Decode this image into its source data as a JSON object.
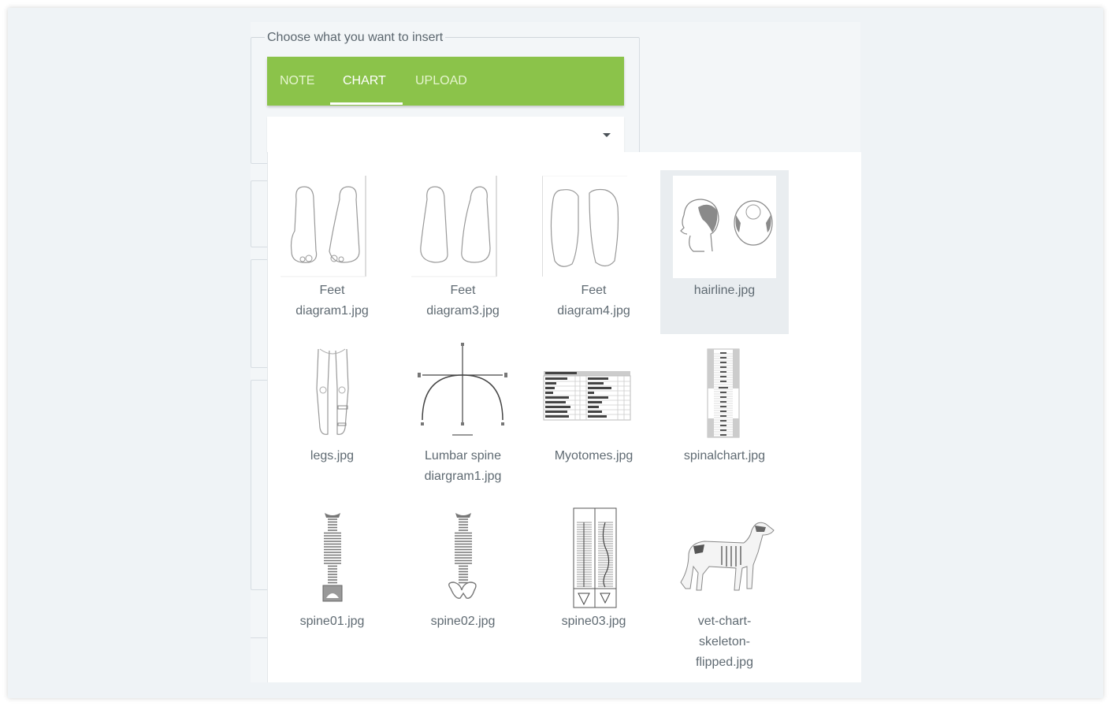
{
  "fieldset": {
    "legend": "Choose what you want to insert"
  },
  "tabs": [
    {
      "label": "NOTE",
      "active": false
    },
    {
      "label": "CHART",
      "active": true
    },
    {
      "label": "UPLOAD",
      "active": false
    }
  ],
  "select": {
    "value": "",
    "icon": "caret-down-icon"
  },
  "colors": {
    "tab_bar": "#8bc34a",
    "selected_item_bg": "#e9edf0",
    "text": "#5f6a72",
    "page_bg": "#eff3f6"
  },
  "menu": {
    "items": [
      {
        "line1": "Feet",
        "line2": "diagram1.jpg",
        "line3": "",
        "thumbnail": "feet-diagram-1",
        "selected": false
      },
      {
        "line1": "Feet",
        "line2": "diagram3.jpg",
        "line3": "",
        "thumbnail": "feet-diagram-3",
        "selected": false
      },
      {
        "line1": "Feet",
        "line2": "diagram4.jpg",
        "line3": "",
        "thumbnail": "feet-diagram-4",
        "selected": false
      },
      {
        "line1": "hairline.jpg",
        "line2": "",
        "line3": "",
        "thumbnail": "hairline",
        "selected": true
      },
      {
        "line1": "legs.jpg",
        "line2": "",
        "line3": "",
        "thumbnail": "legs",
        "selected": false
      },
      {
        "line1": "Lumbar spine",
        "line2": "diargram1.jpg",
        "line3": "",
        "thumbnail": "lumbar-spine",
        "selected": false
      },
      {
        "line1": "Myotomes.jpg",
        "line2": "",
        "line3": "",
        "thumbnail": "myotomes-table",
        "selected": false
      },
      {
        "line1": "spinalchart.jpg",
        "line2": "",
        "line3": "",
        "thumbnail": "spinal-chart",
        "selected": false
      },
      {
        "line1": "spine01.jpg",
        "line2": "",
        "line3": "",
        "thumbnail": "spine-01",
        "selected": false
      },
      {
        "line1": "spine02.jpg",
        "line2": "",
        "line3": "",
        "thumbnail": "spine-02",
        "selected": false
      },
      {
        "line1": "spine03.jpg",
        "line2": "",
        "line3": "",
        "thumbnail": "spine-03",
        "selected": false
      },
      {
        "line1": "vet-chart-",
        "line2": "skeleton-",
        "line3": "flipped.jpg",
        "thumbnail": "dog-skeleton",
        "selected": false
      }
    ]
  }
}
